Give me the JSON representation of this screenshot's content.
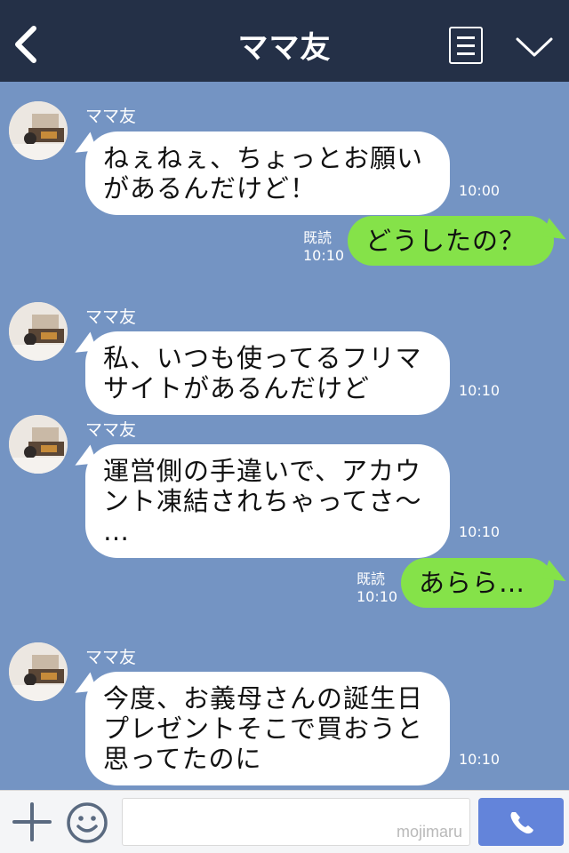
{
  "header": {
    "title": "ママ友"
  },
  "messages": [
    {
      "sender": "ママ友",
      "lines": [
        "ねぇねぇ、ちょっとお願い",
        "があるんだけど！"
      ],
      "time": "10:00"
    },
    {
      "text": "どうしたの？",
      "read": "既読",
      "time": "10:10"
    },
    {
      "sender": "ママ友",
      "lines": [
        "私、いつも使ってるフリマ",
        "サイトがあるんだけど"
      ],
      "time": "10:10"
    },
    {
      "sender": "ママ友",
      "lines": [
        "運営側の手違いで、アカウ",
        "ント凍結されちゃってさ〜",
        "…"
      ],
      "time": "10:10"
    },
    {
      "text": "あらら…",
      "read": "既読",
      "time": "10:10"
    },
    {
      "sender": "ママ友",
      "lines": [
        "今度、お義母さんの誕生日",
        "プレゼントそこで買おうと",
        "思ってたのに"
      ],
      "time": "10:10"
    }
  ],
  "inputbar": {
    "watermark": "mojimaru"
  },
  "colors": {
    "header": "#243047",
    "chat_bg": "#7494c3",
    "my_bubble": "#85e249",
    "call_button": "#6384da"
  }
}
